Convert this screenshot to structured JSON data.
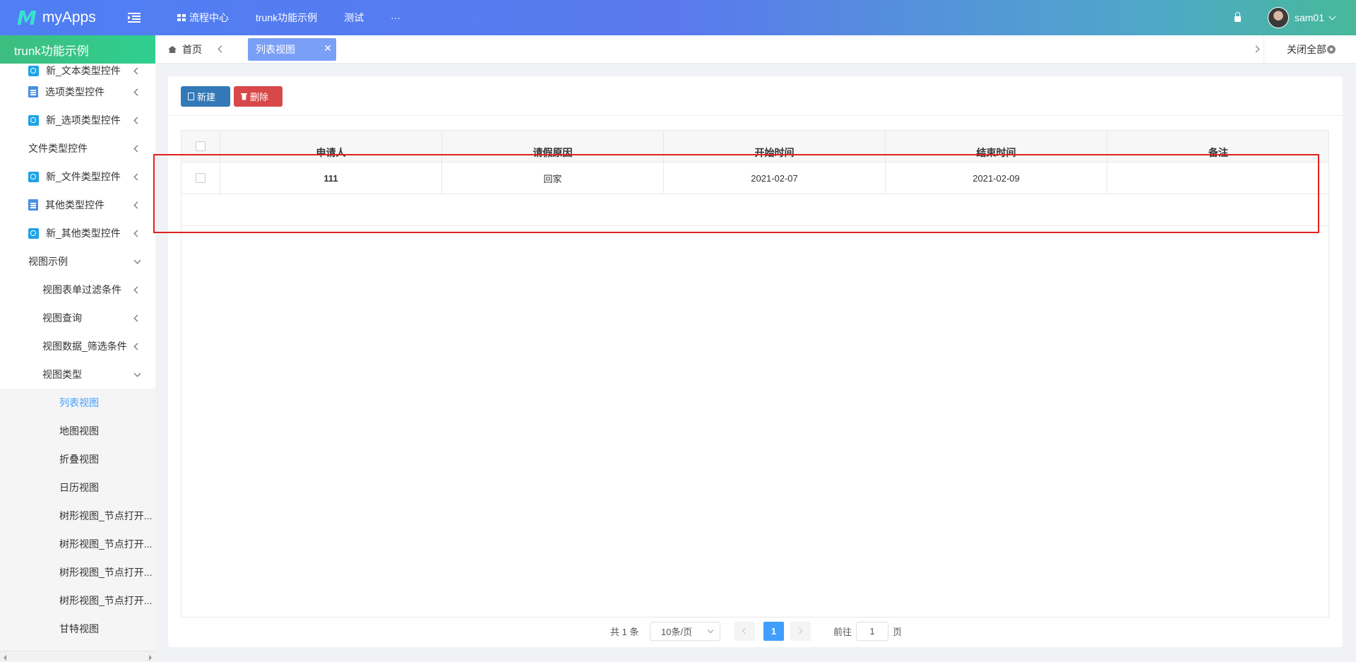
{
  "header": {
    "logo_mark": "M",
    "app_name": "myApps",
    "nav": [
      {
        "label": "流程中心"
      },
      {
        "label": "trunk功能示例"
      },
      {
        "label": "测试"
      },
      {
        "label": "···"
      }
    ],
    "user_name": "sam01"
  },
  "sidebar": {
    "title": "trunk功能示例",
    "items": [
      {
        "label": "新_文本类型控件",
        "icon": "new-form-icon"
      },
      {
        "label": "选项类型控件",
        "icon": "document-icon"
      },
      {
        "label": "新_选项类型控件",
        "icon": "new-form-icon"
      },
      {
        "label": "文件类型控件",
        "icon": ""
      },
      {
        "label": "新_文件类型控件",
        "icon": "new-form-icon"
      },
      {
        "label": "其他类型控件",
        "icon": "document-icon"
      },
      {
        "label": "新_其他类型控件",
        "icon": "new-form-icon"
      },
      {
        "label": "视图示例",
        "icon": ""
      },
      {
        "label": "视图表单过滤条件",
        "icon": ""
      },
      {
        "label": "视图查询",
        "icon": ""
      },
      {
        "label": "视图数据_筛选条件",
        "icon": ""
      },
      {
        "label": "视图类型",
        "icon": ""
      },
      {
        "label": "列表视图",
        "icon": ""
      },
      {
        "label": "地图视图",
        "icon": ""
      },
      {
        "label": "折叠视图",
        "icon": ""
      },
      {
        "label": "日历视图",
        "icon": ""
      },
      {
        "label": "树形视图_节点打开...",
        "icon": ""
      },
      {
        "label": "树形视图_节点打开...",
        "icon": ""
      },
      {
        "label": "树形视图_节点打开...",
        "icon": ""
      },
      {
        "label": "树形视图_节点打开...",
        "icon": ""
      },
      {
        "label": "甘特视图",
        "icon": ""
      }
    ]
  },
  "tabs": {
    "home_label": "首页",
    "active_label": "列表视图",
    "close_symbol": "✕",
    "close_all_label": "关闭全部"
  },
  "toolbar": {
    "new_label": "新建",
    "delete_label": "删除"
  },
  "table": {
    "columns": [
      "申请人",
      "请假原因",
      "开始时间",
      "结束时间",
      "备注"
    ],
    "rows": [
      [
        "111",
        "回家",
        "2021-02-07",
        "2021-02-09",
        ""
      ]
    ]
  },
  "pagination": {
    "total_text": "共 1 条",
    "page_size": "10条/页",
    "current_page": "1",
    "goto_prefix": "前往",
    "goto_value": "1",
    "goto_suffix": "页"
  },
  "colors": {
    "header_gradient_start": "#4f7ff3",
    "header_gradient_end": "#47b99a",
    "sidebar_head": "#3dbd80",
    "active_tab": "#7a9ff7",
    "new_button": "#3379b7",
    "delete_button": "#d84848",
    "highlight_box": "#e02020",
    "page_active": "#409eff"
  }
}
